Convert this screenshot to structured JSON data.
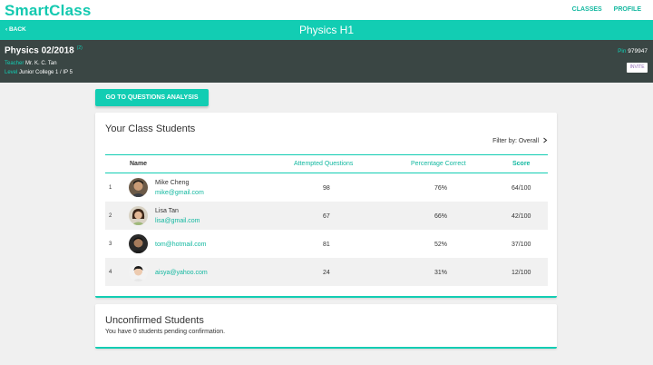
{
  "app": {
    "brand": "SmartClass"
  },
  "nav": {
    "classes": "CLASSES",
    "profile": "PROFILE"
  },
  "titlebar": {
    "back": "‹ BACK",
    "title": "Physics H1"
  },
  "class_info": {
    "name": "Physics 02/2018",
    "tag": "(2)",
    "teacher_label": "Teacher",
    "teacher": "Mr. K. C. Tan",
    "level_label": "Level",
    "level": "Junior College 1 / IP 5",
    "pin_label": "Pin",
    "pin": "979947",
    "invite": "INVITE"
  },
  "actions": {
    "questions_analysis": "GO TO QUESTIONS ANALYSIS"
  },
  "students_card": {
    "title": "Your Class Students",
    "filter": "Filter by: Overall",
    "headers": {
      "name": "Name",
      "attempted": "Attempted Questions",
      "percentage": "Percentage Correct",
      "score": "Score"
    },
    "rows": [
      {
        "idx": "1",
        "name": "Mike Cheng",
        "email": "mike@gmail.com",
        "attempted": "98",
        "percentage": "76%",
        "score": "64/100"
      },
      {
        "idx": "2",
        "name": "Lisa Tan",
        "email": "lisa@gmail.com",
        "attempted": "67",
        "percentage": "66%",
        "score": "42/100"
      },
      {
        "idx": "3",
        "name": "",
        "email": "tom@hotmail.com",
        "attempted": "81",
        "percentage": "52%",
        "score": "37/100"
      },
      {
        "idx": "4",
        "name": "",
        "email": "aisya@yahoo.com",
        "attempted": "24",
        "percentage": "31%",
        "score": "12/100"
      }
    ]
  },
  "unconfirmed_card": {
    "title": "Unconfirmed Students",
    "message": "You have 0 students pending confirmation."
  },
  "colors": {
    "accent": "#12cdb3",
    "dark_bar": "#3a4644",
    "invite_text": "#8e6bb5"
  }
}
